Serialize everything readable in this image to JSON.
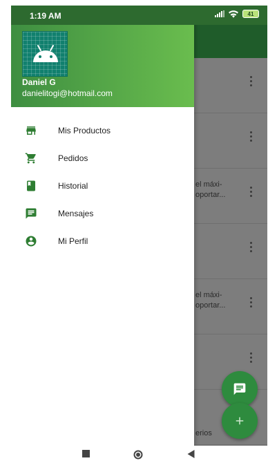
{
  "status_bar": {
    "time": "1:19 AM",
    "battery": "41"
  },
  "drawer": {
    "user_name": "Daniel G",
    "user_email": "danielitogi@hotmail.com",
    "items": [
      {
        "label": "Mis Productos",
        "icon": "store-icon"
      },
      {
        "label": "Pedidos",
        "icon": "cart-icon"
      },
      {
        "label": "Historial",
        "icon": "book-icon"
      },
      {
        "label": "Mensajes",
        "icon": "message-icon"
      },
      {
        "label": "Mi Perfil",
        "icon": "account-circle-icon"
      }
    ]
  },
  "background_list": {
    "rows": [
      {
        "text": ""
      },
      {
        "text": ""
      },
      {
        "text": "el máxi-\noportar..."
      },
      {
        "text": ""
      },
      {
        "text": "el máxi-\noportar..."
      },
      {
        "text": ""
      },
      {
        "text": "erios"
      }
    ]
  },
  "colors": {
    "header_start": "#3e8e41",
    "header_end": "#6abd4e",
    "accent": "#2e8b3e",
    "icon": "#2e7d32"
  }
}
